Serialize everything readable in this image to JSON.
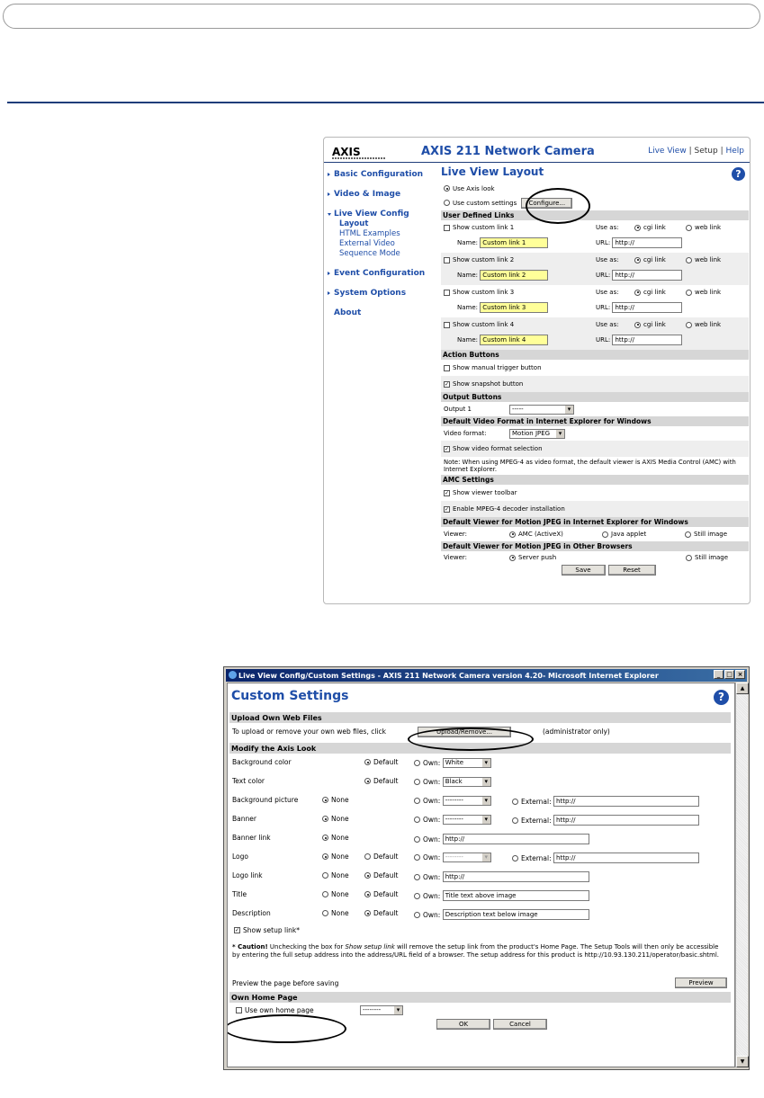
{
  "page": {
    "rule_color": "#1f3d7a"
  },
  "layout_panel": {
    "logo": "AXIS",
    "title": "AXIS 211 Network Camera",
    "top_links": [
      "Live View",
      "Setup",
      "Help"
    ],
    "menu": {
      "basic": "Basic Configuration",
      "video": "Video & Image",
      "liveview": "Live View Config",
      "subs": [
        "Layout",
        "HTML Examples",
        "External Video",
        "Sequence Mode"
      ],
      "event": "Event Configuration",
      "system": "System Options",
      "about": "About"
    },
    "heading": "Live View Layout",
    "use_axis_look": "Use Axis look",
    "use_custom": "Use custom settings",
    "configure_btn": "Configure...",
    "sect_user_links": "User Defined Links",
    "links": [
      {
        "label": "Show custom link 1",
        "name": "Custom link 1",
        "url": "http://"
      },
      {
        "label": "Show custom link 2",
        "name": "Custom link 2",
        "url": "http://"
      },
      {
        "label": "Show custom link 3",
        "name": "Custom link 3",
        "url": "http://"
      },
      {
        "label": "Show custom link 4",
        "name": "Custom link 4",
        "url": "http://"
      }
    ],
    "name_label": "Name:",
    "use_as": "Use as:",
    "cgi": "cgi link",
    "web": "web link",
    "url_label": "URL:",
    "sect_action": "Action Buttons",
    "manual_trigger": "Show manual trigger button",
    "snapshot": "Show snapshot button",
    "sect_output": "Output Buttons",
    "output1": "Output 1",
    "output_sel": "-----",
    "sect_video_fmt": "Default Video Format in Internet Explorer for Windows",
    "video_fmt_label": "Video format:",
    "video_fmt_val": "Motion JPEG",
    "show_fmt_sel": "Show video format selection",
    "note": "Note: When using MPEG-4 as video format, the default viewer is AXIS Media Control (AMC) with Internet Explorer.",
    "sect_amc": "AMC Settings",
    "viewer_toolbar": "Show viewer toolbar",
    "mpeg4_install": "Enable MPEG-4 decoder installation",
    "sect_mjpeg_ie": "Default Viewer for Motion JPEG in Internet Explorer for Windows",
    "viewer_label": "Viewer:",
    "amc": "AMC (ActiveX)",
    "java": "Java applet",
    "still": "Still image",
    "sect_mjpeg_other": "Default Viewer for Motion JPEG in Other Browsers",
    "server_push": "Server push",
    "save": "Save",
    "reset": "Reset"
  },
  "custom_window": {
    "title": "Live View Config/Custom Settings - AXIS 211 Network Camera version 4.20- Microsoft Internet Explorer",
    "heading": "Custom Settings",
    "sect_upload": "Upload Own Web Files",
    "upload_text": "To upload or remove your own web files, click",
    "upload_btn": "Upload/Remove...",
    "admin_only": "(administrator only)",
    "sect_modify": "Modify the Axis Look",
    "rows": {
      "bgcolor": "Background color",
      "textcolor": "Text color",
      "bgpic": "Background picture",
      "banner": "Banner",
      "bannerlink": "Banner link",
      "logo": "Logo",
      "logolink": "Logo link",
      "title": "Title",
      "description": "Description"
    },
    "none": "None",
    "default": "Default",
    "own": "Own:",
    "external": "External:",
    "white": "White",
    "black": "Black",
    "dashes": "--------",
    "http": "http://",
    "title_text": "Title text above image",
    "desc_text": "Description text below image",
    "show_setup": "Show setup link*",
    "caution_bold": "* Caution!",
    "caution_text": " Unchecking the box for ",
    "caution_em": "Show setup link",
    "caution_rest": " will remove the setup link from the product's Home Page. The Setup Tools will then only be accessible by entering the full setup address into the address/URL field of a browser. The setup address for this product is http://10.93.130.211/operator/basic.shtml.",
    "preview_text": "Preview the page before saving",
    "preview_btn": "Preview",
    "sect_home": "Own Home Page",
    "use_home": "Use own home page",
    "home_sel": "--------",
    "ok": "OK",
    "cancel": "Cancel"
  }
}
